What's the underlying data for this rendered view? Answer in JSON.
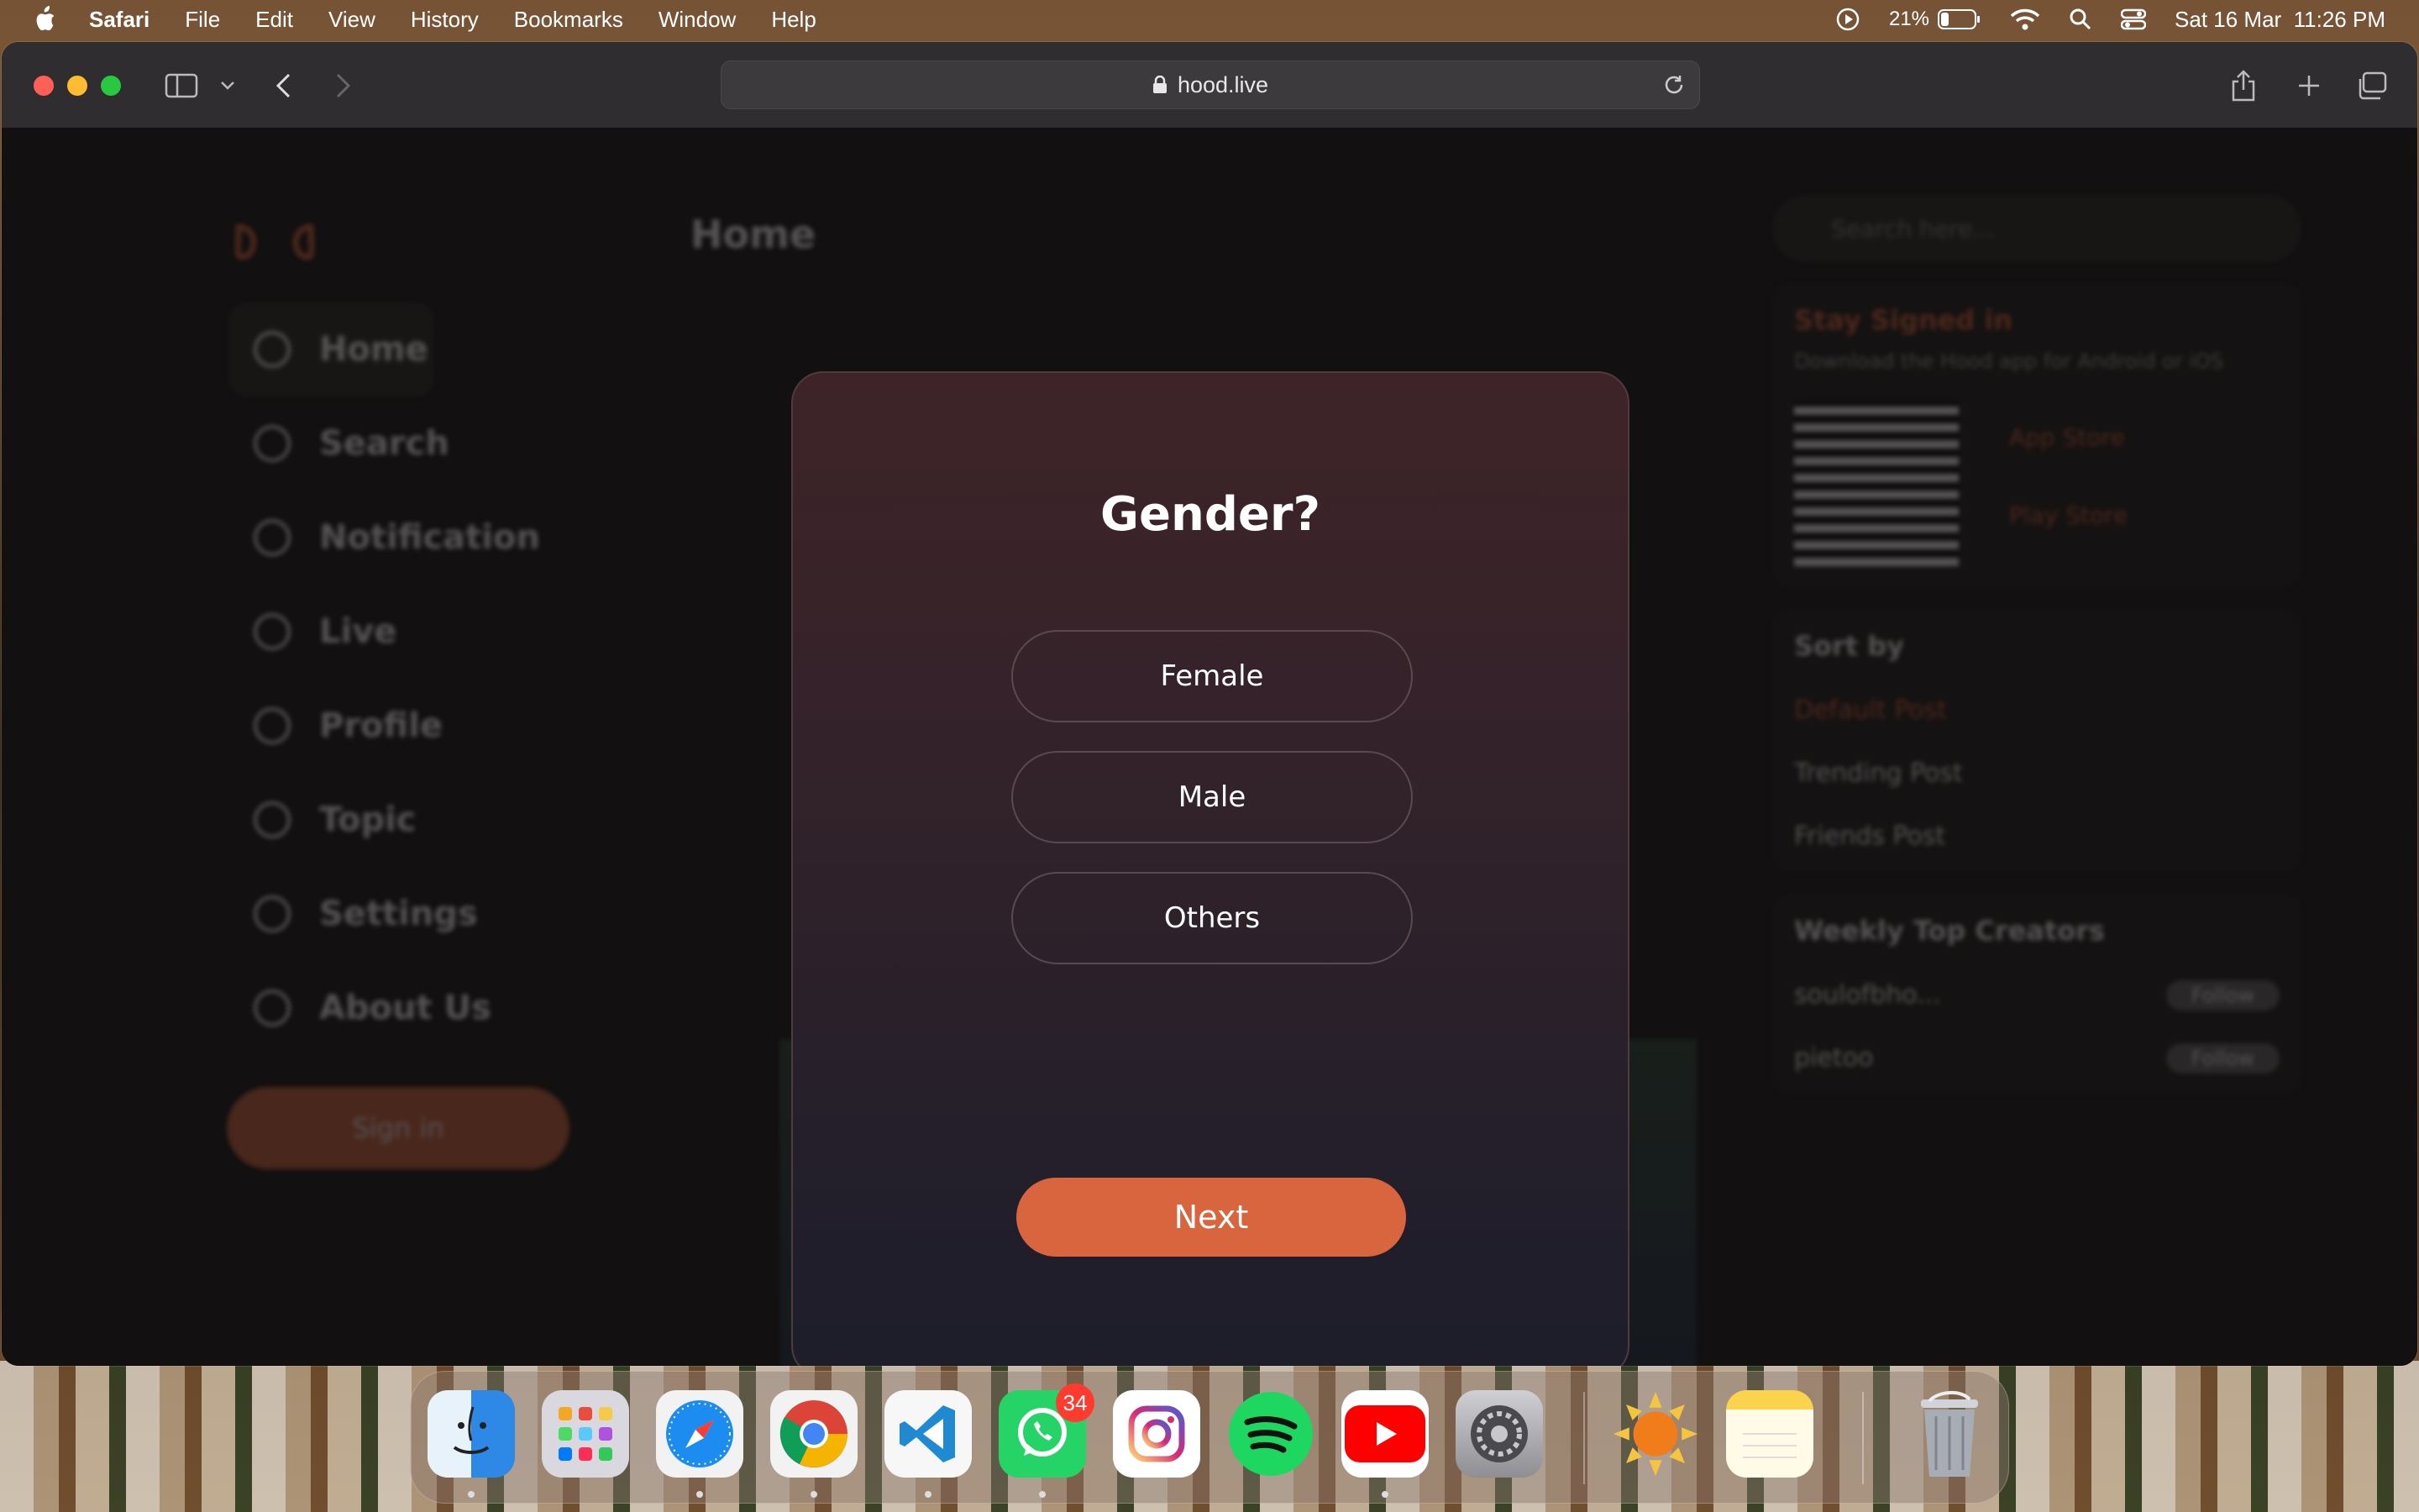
{
  "menubar": {
    "app_name": "Safari",
    "items": [
      "File",
      "Edit",
      "View",
      "History",
      "Bookmarks",
      "Window",
      "Help"
    ],
    "battery_percent": "21%",
    "datetime": "Sat 16 Mar  11:26 PM"
  },
  "browser": {
    "url": "hood.live"
  },
  "page": {
    "title": "Home",
    "nav_items": [
      "Home",
      "Search",
      "Notification",
      "Live",
      "Profile",
      "Topic",
      "Settings",
      "About Us"
    ],
    "signin_label": "Sign in",
    "search_placeholder": "Search here...",
    "stay_signed_in": "Stay Signed in",
    "download_note": "Download the Hood app for Android or iOS",
    "app_store": "App Store",
    "play_store": "Play Store",
    "sort_by": "Sort by",
    "sort_options": [
      "Default Post",
      "Trending Post",
      "Friends Post"
    ],
    "weekly_top": "Weekly Top Creators",
    "creators": [
      "soulofbho...",
      "pietoo"
    ],
    "follow_label": "Follow"
  },
  "modal": {
    "title": "Gender?",
    "options": [
      "Female",
      "Male",
      "Others"
    ],
    "next_label": "Next"
  },
  "dock": {
    "whatsapp_badge": "34",
    "apps": [
      "finder-icon",
      "launchpad-icon",
      "safari-icon",
      "chrome-icon",
      "vscode-icon",
      "whatsapp-icon",
      "instagram-icon",
      "spotify-icon",
      "youtube-icon",
      "system-settings-icon",
      "weather-icon",
      "notes-icon",
      "trash-icon"
    ]
  },
  "colors": {
    "accent": "#d9653f",
    "modal_top": "#3e2428",
    "modal_bottom": "#1d1d2a"
  }
}
